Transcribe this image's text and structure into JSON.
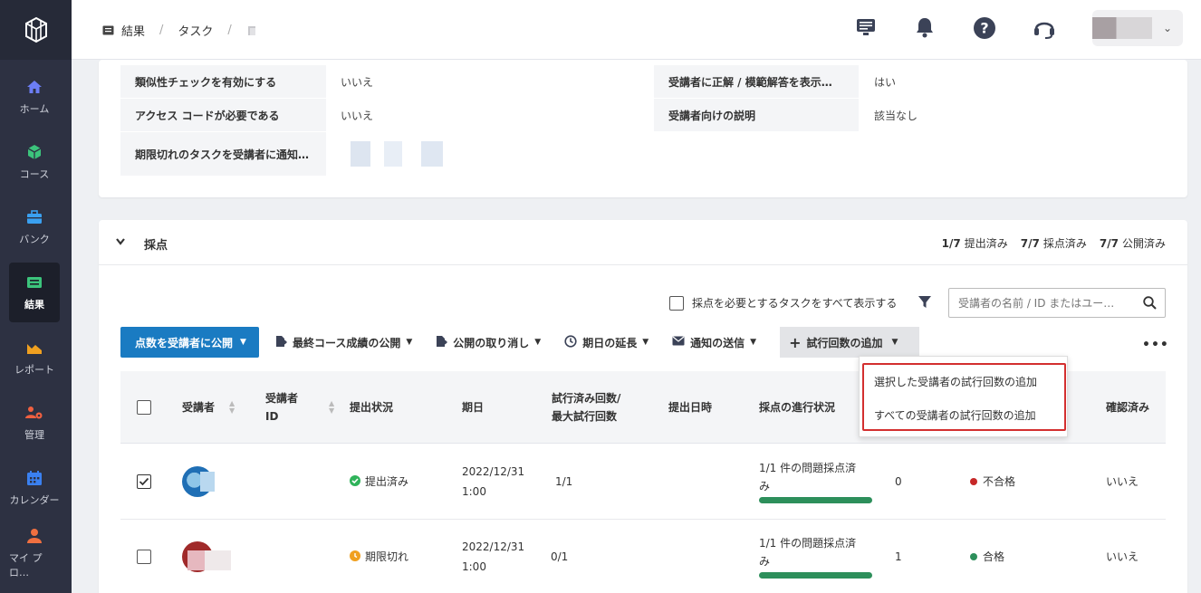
{
  "breadcrumb": {
    "item1": "結果",
    "sep1": "/",
    "item2": "タスク",
    "sep2": "/"
  },
  "topbar": {
    "icons": [
      "monitor-icon",
      "bell-icon",
      "help-icon",
      "headset-icon"
    ],
    "chevron": "⌄"
  },
  "sidebar": {
    "items": [
      {
        "label": "ホーム",
        "icon": "home-icon",
        "color": "#6c7ef5"
      },
      {
        "label": "コース",
        "icon": "cube-icon",
        "color": "#3cc47c"
      },
      {
        "label": "バンク",
        "icon": "briefcase-icon",
        "color": "#3aa0f0"
      },
      {
        "label": "結果",
        "icon": "results-icon",
        "color": "#3cc47c"
      },
      {
        "label": "レポート",
        "icon": "chart-icon",
        "color": "#f0a020"
      },
      {
        "label": "管理",
        "icon": "users-gear-icon",
        "color": "#f06040"
      },
      {
        "label": "カレンダー",
        "icon": "calendar-icon",
        "color": "#3a80f0"
      },
      {
        "label": "マイ プロ…",
        "icon": "user-icon",
        "color": "#f07040"
      }
    ]
  },
  "settings": {
    "rows": [
      {
        "label": "類似性チェックを有効にする",
        "value": "いいえ"
      },
      {
        "label": "アクセス コードが必要である",
        "value": "いいえ"
      },
      {
        "label": "期限切れのタスクを受講者に通知…",
        "value": ""
      }
    ],
    "rows_right": [
      {
        "label": "受講者に正解 / 模範解答を表示…",
        "value": "はい"
      },
      {
        "label": "受講者向けの説明",
        "value": "該当なし"
      }
    ]
  },
  "grading": {
    "title": "採点",
    "stats": [
      {
        "value": "1/7",
        "label": "提出済み"
      },
      {
        "value": "7/7",
        "label": "採点済み"
      },
      {
        "value": "7/7",
        "label": "公開済み"
      }
    ],
    "show_all_label": "採点を必要とするタスクをすべて表示する",
    "search_placeholder": "受講者の名前 / ID またはユー…",
    "toolbar": {
      "publish": "点数を受講者に公開",
      "final_publish": "最終コース成績の公開",
      "unpublish": "公開の取り消し",
      "extend": "期日の延長",
      "notify": "通知の送信",
      "add_attempts": "試行回数の追加"
    },
    "dropdown": [
      "選択した受講者の試行回数の追加",
      "すべての受講者の試行回数の追加"
    ],
    "columns": {
      "student": "受講者",
      "student_id_1": "受講者",
      "student_id_2": "ID",
      "status": "提出状況",
      "due": "期日",
      "attempts_1": "試行済み回数/",
      "attempts_2": "最大試行回数",
      "submitted": "提出日時",
      "progress": "採点の進行状況",
      "confirmed": "確認済み"
    },
    "rows": [
      {
        "checked": true,
        "status": "提出済み",
        "status_color": "#2fb35a",
        "due_1": "2022/12/31",
        "due_2": "1:00",
        "attempts": "1/1",
        "progress_1": "1/1 件の問題採点済",
        "progress_2": "み",
        "progress_fraction": 1.0,
        "score": "0",
        "result": "不合格",
        "result_color": "#c62828",
        "confirmed": "いいえ"
      },
      {
        "checked": false,
        "status": "期限切れ",
        "status_color": "#f0a020",
        "due_1": "2022/12/31",
        "due_2": "1:00",
        "attempts": "0/1",
        "progress_1": "1/1 件の問題採点済",
        "progress_2": "み",
        "progress_fraction": 1.0,
        "score": "1",
        "result": "合格",
        "result_color": "#2d8f5b",
        "confirmed": "いいえ"
      }
    ]
  }
}
